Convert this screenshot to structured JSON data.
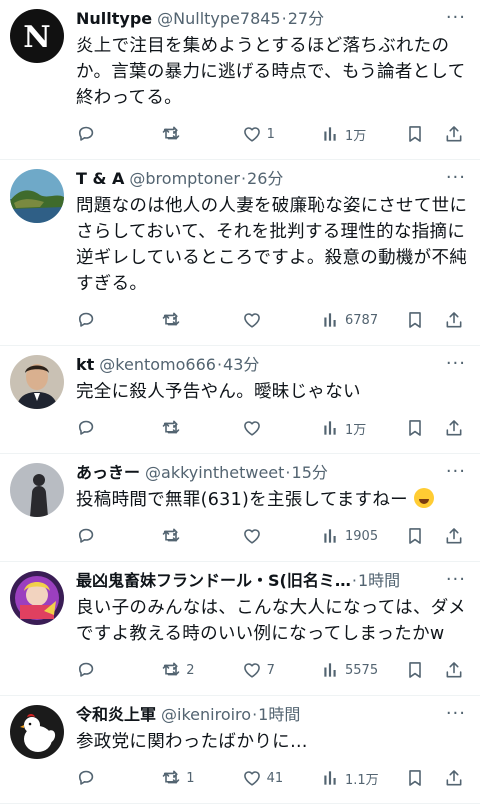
{
  "tweets": [
    {
      "name": "Nulltype",
      "handle": "@Nulltype7845",
      "sep": "·",
      "time": "27分",
      "text": "炎上で注目を集めようとするほど落ちぶれたのか。言葉の暴力に逃げる時点で、もう論者として終わってる。",
      "replies": "",
      "retweets": "",
      "likes": "1",
      "views": "1万"
    },
    {
      "name": "T & A",
      "handle": "@bromptoner",
      "sep": "·",
      "time": "26分",
      "text": "問題なのは他人の人妻を破廉恥な姿にさせて世にさらしておいて、それを批判する理性的な指摘に逆ギレしているところですよ。殺意の動機が不純すぎる。",
      "replies": "",
      "retweets": "",
      "likes": "",
      "views": "6787"
    },
    {
      "name": "kt",
      "handle": "@kentomo666",
      "sep": "·",
      "time": "43分",
      "text": "完全に殺人予告やん。曖昧じゃない",
      "replies": "",
      "retweets": "",
      "likes": "",
      "views": "1万"
    },
    {
      "name": "あっきー",
      "handle": "@akkyinthetweet",
      "sep": "·",
      "time": "15分",
      "text": "投稿時間で無罪(631)を主張してますねー",
      "emoji": "sweat-smile-emoji",
      "replies": "",
      "retweets": "",
      "likes": "",
      "views": "1905"
    },
    {
      "name": "最凶鬼畜妹フランドール・S(旧名ミ…",
      "handle": "",
      "sep": "·",
      "time": "1時間",
      "text": "良い子のみんなは、こんな大人になっては、ダメですよ教える時のいい例になってしまったかw",
      "replies": "",
      "retweets": "2",
      "likes": "7",
      "views": "5575"
    },
    {
      "name": "令和炎上軍",
      "handle": "@ikeniroiro",
      "sep": "·",
      "time": "1時間",
      "text": "参政党に関わったばかりに…",
      "replies": "",
      "retweets": "1",
      "likes": "41",
      "views": "1.1万"
    }
  ],
  "colors": {
    "text": "#0f1419",
    "muted": "#536471",
    "divider": "#eff3f4"
  },
  "icons": [
    "reply-icon",
    "retweet-icon",
    "like-icon",
    "views-icon",
    "bookmark-icon",
    "share-icon",
    "more-icon"
  ]
}
